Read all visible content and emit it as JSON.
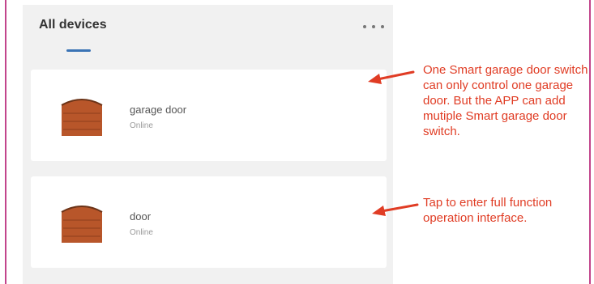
{
  "header": {
    "title": "All devices"
  },
  "icons": {
    "more": "more-horizontal-icon",
    "door": "garage-door-icon",
    "arrow": "red-arrow-left-icon"
  },
  "colors": {
    "accent": "#3a73b5",
    "annotation": "#e03c24",
    "door": "#b8562a",
    "frame": "#c2458c"
  },
  "devices": [
    {
      "name": "garage door",
      "status": "Online"
    },
    {
      "name": "door",
      "status": "Online"
    }
  ],
  "annotations": [
    "One Smart garage door switch can only control one garage door. But the APP can add mutiple Smart garage door switch.",
    "Tap to enter full function operation interface."
  ]
}
